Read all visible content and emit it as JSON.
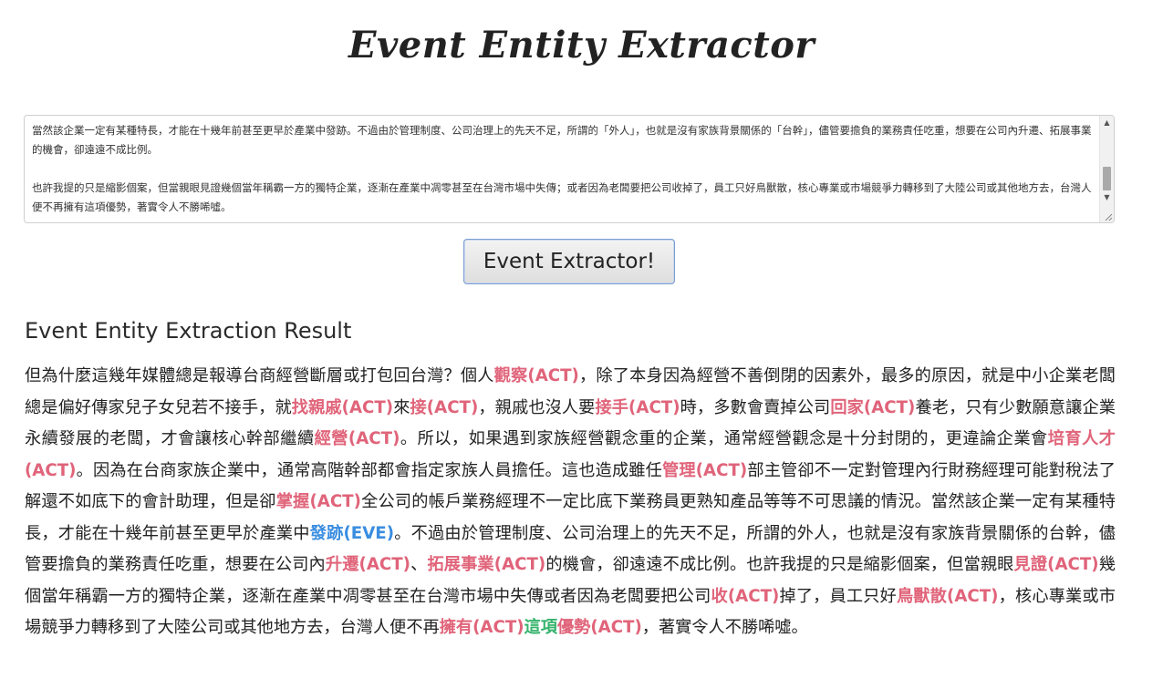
{
  "page": {
    "title": "Event Entity Extractor"
  },
  "input": {
    "text": "當然該企業一定有某種特長，才能在十幾年前甚至更早於產業中發跡。不過由於管理制度、公司治理上的先天不足，所謂的「外人」，也就是沒有家族背景關係的「台幹」，儘管要擔負的業務責任吃重，想要在公司內升遷、拓展事業的機會，卻遠遠不成比例。\n\n也許我提的只是縮影個案，但當親眼見證幾個當年稱霸一方的獨特企業，逐漸在產業中凋零甚至在台灣市場中失傳；或者因為老闆要把公司收掉了，員工只好鳥獸散，核心專業或市場競爭力轉移到了大陸公司或其他地方去，台灣人便不再擁有這項優勢，著實令人不勝唏噓。"
  },
  "button": {
    "label": "Event Extractor!"
  },
  "result": {
    "heading": "Event Entity Extraction Result",
    "segments": [
      {
        "t": "但為什麼這幾年媒體總是報導台商經營斷層或打包回台灣？個人"
      },
      {
        "t": "觀察(ACT)",
        "c": "act"
      },
      {
        "t": "，除了本身因為經營不善倒閉的因素外，最多的原因，就是中小企業老闆總是偏好傳家兒子女兒若不接手，就"
      },
      {
        "t": "找親戚(ACT)",
        "c": "act"
      },
      {
        "t": "來"
      },
      {
        "t": "接(ACT)",
        "c": "act"
      },
      {
        "t": "，親戚也沒人要"
      },
      {
        "t": "接手(ACT)",
        "c": "act"
      },
      {
        "t": "時，多數會賣掉公司"
      },
      {
        "t": "回家(ACT)",
        "c": "act"
      },
      {
        "t": "養老，只有少數願意讓企業永續發展的老闆，才會讓核心幹部繼續"
      },
      {
        "t": "經營(ACT)",
        "c": "act"
      },
      {
        "t": "。所以，如果遇到家族經營觀念重的企業，通常經營觀念是十分封閉的，更違論企業會"
      },
      {
        "t": "培育人才(ACT)",
        "c": "act"
      },
      {
        "t": "。因為在台商家族企業中，通常高階幹部都會指定家族人員擔任。這也造成雖任"
      },
      {
        "t": "管理(ACT)",
        "c": "act"
      },
      {
        "t": "部主管卻不一定對管理內行財務經理可能對稅法了解還不如底下的會計助理，但是卻"
      },
      {
        "t": "掌握(ACT)",
        "c": "act"
      },
      {
        "t": "全公司的帳戶業務經理不一定比底下業務員更熟知產品等等不可思議的情況。當然該企業一定有某種特長，才能在十幾年前甚至更早於產業中"
      },
      {
        "t": "發跡(EVE)",
        "c": "eve"
      },
      {
        "t": "。不過由於管理制度、公司治理上的先天不足，所謂的外人，也就是沒有家族背景關係的台幹，儘管要擔負的業務責任吃重，想要在公司內"
      },
      {
        "t": "升遷(ACT)",
        "c": "act"
      },
      {
        "t": "、"
      },
      {
        "t": "拓展事業(ACT)",
        "c": "act"
      },
      {
        "t": "的機會，卻遠遠不成比例。也許我提的只是縮影個案，但當親眼"
      },
      {
        "t": "見證(ACT)",
        "c": "act"
      },
      {
        "t": "幾個當年稱霸一方的獨特企業，逐漸在產業中凋零甚至在台灣市場中失傳或者因為老闆要把公司"
      },
      {
        "t": "收(ACT)",
        "c": "act"
      },
      {
        "t": "掉了，員工只好"
      },
      {
        "t": "鳥獸散(ACT)",
        "c": "act"
      },
      {
        "t": "，核心專業或市場競爭力轉移到了大陸公司或其他地方去，台灣人便不再"
      },
      {
        "t": "擁有(ACT)",
        "c": "act"
      },
      {
        "t": "這項",
        "c": "ent"
      },
      {
        "t": "優勢(ACT)",
        "c": "act"
      },
      {
        "t": "，著實令人不勝唏噓。"
      }
    ]
  },
  "colors": {
    "act": "#e0647a",
    "eve": "#3a8de0",
    "entity": "#36b36c"
  }
}
